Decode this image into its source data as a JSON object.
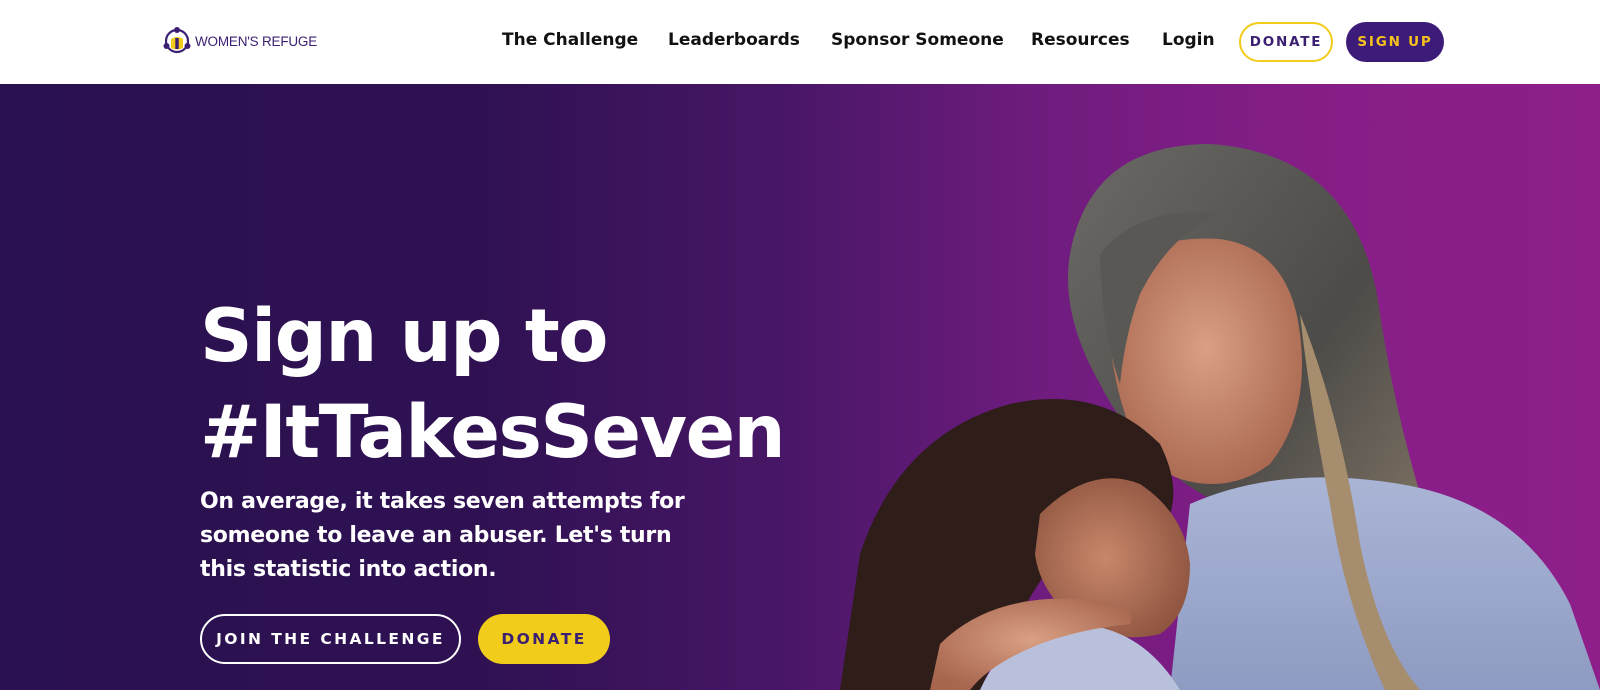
{
  "header": {
    "logo_text": "WOMEN'S REFUGE",
    "nav": [
      {
        "label": "The Challenge"
      },
      {
        "label": "Leaderboards"
      },
      {
        "label": "Sponsor Someone"
      },
      {
        "label": "Resources"
      },
      {
        "label": "Login"
      }
    ],
    "donate_label": "DONATE",
    "signup_label": "SIGN UP"
  },
  "hero": {
    "title_line1": "Sign up to",
    "title_line2": "#ItTakesSeven",
    "subtitle": "On average, it takes seven attempts for someone to leave an abuser. Let's turn this statistic into action.",
    "join_label": "JOIN THE CHALLENGE",
    "donate_label": "DONATE"
  },
  "colors": {
    "brand_purple": "#3d1b78",
    "accent_yellow": "#f2cc1a",
    "hero_gradient_start": "#2a1150",
    "hero_gradient_end": "#8e1f8a"
  }
}
